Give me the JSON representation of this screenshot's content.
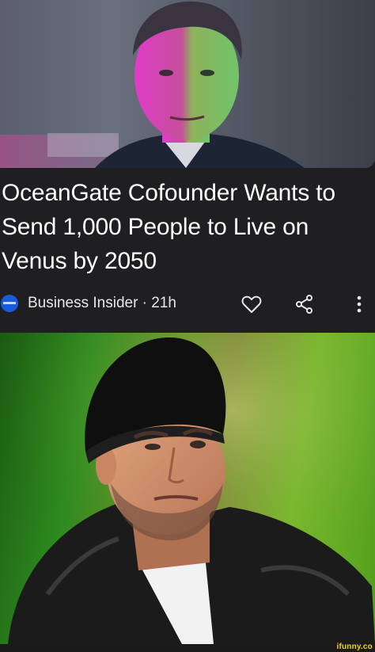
{
  "article": {
    "headline": "OceanGate Cofounder Wants to Send 1,000 People to Live on Venus by 2050",
    "source": "Business Insider",
    "age": "21h",
    "source_line": "Business Insider · 21h",
    "publisher_logo_icon": "business-insider-logo-icon",
    "actions": [
      "heart-icon",
      "share-icon",
      "more-vert-icon"
    ]
  },
  "colors": {
    "card_background": "#1f1f22",
    "headline_text": "#ffffff",
    "publisher_logo": "#1a5bd8",
    "watermark": "#f2d21b"
  },
  "watermark": "ifunny.co"
}
